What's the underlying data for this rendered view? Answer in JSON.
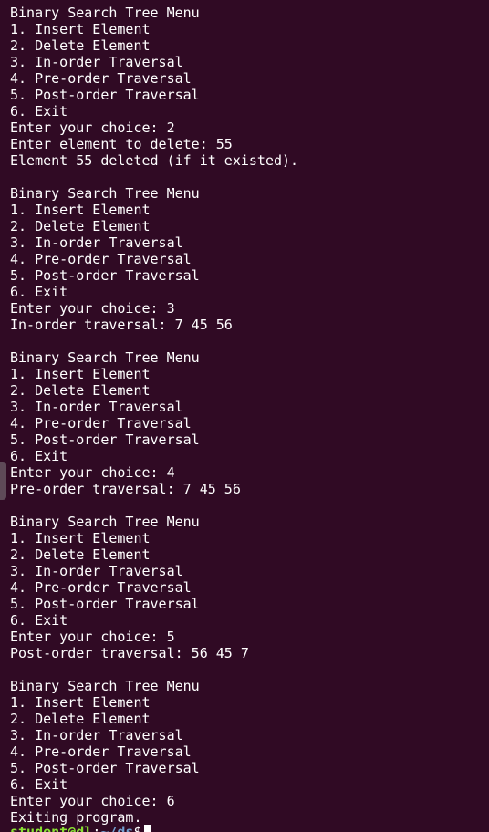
{
  "terminal": {
    "background": "#300a24",
    "foreground": "#ffffff",
    "lines": [
      "Binary Search Tree Menu",
      "1. Insert Element",
      "2. Delete Element",
      "3. In-order Traversal",
      "4. Pre-order Traversal",
      "5. Post-order Traversal",
      "6. Exit",
      "Enter your choice: 2",
      "Enter element to delete: 55",
      "Element 55 deleted (if it existed).",
      "",
      "Binary Search Tree Menu",
      "1. Insert Element",
      "2. Delete Element",
      "3. In-order Traversal",
      "4. Pre-order Traversal",
      "5. Post-order Traversal",
      "6. Exit",
      "Enter your choice: 3",
      "In-order traversal: 7 45 56",
      "",
      "Binary Search Tree Menu",
      "1. Insert Element",
      "2. Delete Element",
      "3. In-order Traversal",
      "4. Pre-order Traversal",
      "5. Post-order Traversal",
      "6. Exit",
      "Enter your choice: 4",
      "Pre-order traversal: 7 45 56",
      "",
      "Binary Search Tree Menu",
      "1. Insert Element",
      "2. Delete Element",
      "3. In-order Traversal",
      "4. Pre-order Traversal",
      "5. Post-order Traversal",
      "6. Exit",
      "Enter your choice: 5",
      "Post-order traversal: 56 45 7",
      "",
      "Binary Search Tree Menu",
      "1. Insert Element",
      "2. Delete Element",
      "3. In-order Traversal",
      "4. Pre-order Traversal",
      "5. Post-order Traversal",
      "6. Exit",
      "Enter your choice: 6",
      "Exiting program."
    ],
    "prompt": {
      "user_host": "student@dl",
      "separator": ":",
      "path": "~/ds",
      "symbol": "$",
      "user_color": "#8ae234",
      "path_color": "#729fcf"
    }
  }
}
